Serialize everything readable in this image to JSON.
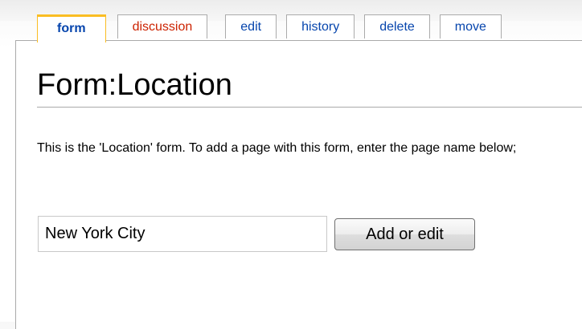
{
  "tabs": [
    {
      "label": "form",
      "selected": true
    },
    {
      "label": "discussion",
      "color": "#cc2200"
    },
    {
      "label": "edit"
    },
    {
      "label": "history"
    },
    {
      "label": "delete"
    },
    {
      "label": "move"
    }
  ],
  "page": {
    "title": "Form:Location",
    "intro": "This is the 'Location' form. To add a page with this form, enter the page name below;"
  },
  "form": {
    "input_value": "New York City",
    "submit_label": "Add or edit"
  },
  "colors": {
    "selected_tab_accent": "#fabd23",
    "link": "#0645ad",
    "new_link": "#cc2200",
    "border": "#aaaaaa"
  }
}
